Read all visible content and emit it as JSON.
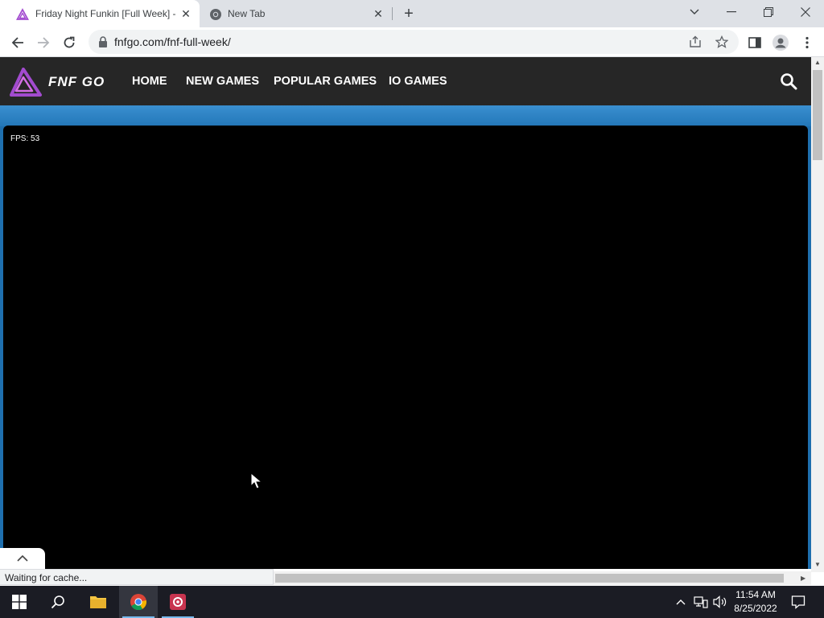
{
  "browser": {
    "tabs": [
      {
        "title": "Friday Night Funkin [Full Week] -",
        "close": "✕"
      },
      {
        "title": "New Tab",
        "close": "✕"
      }
    ],
    "new_tab": "+",
    "url": "fnfgo.com/fnf-full-week/"
  },
  "site": {
    "logo_text": "FNF GO",
    "nav": [
      "HOME",
      "NEW GAMES",
      "POPULAR GAMES",
      "IO GAMES"
    ]
  },
  "game": {
    "fps_text": "FPS: 53"
  },
  "status": "Waiting for cache...",
  "taskbar": {
    "time": "11:54 AM",
    "date": "8/25/2022"
  },
  "colors": {
    "site_nav_bg": "#262626",
    "page_blue": "#1e6fae",
    "logo_purple": "#a24bcf",
    "taskbar_bg": "#1b1c24"
  }
}
